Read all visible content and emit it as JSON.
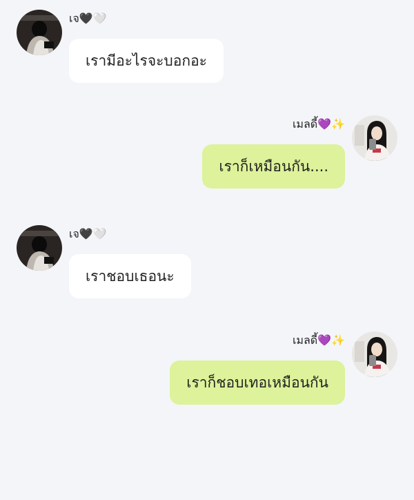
{
  "conversation": {
    "messages": [
      {
        "side": "left",
        "sender": "เจ🖤🤍",
        "text": "เรามีอะไรจะบอกอะ"
      },
      {
        "side": "right",
        "sender": "เมลดี้💜✨",
        "text": "เราก็เหมือนกัน...."
      },
      {
        "side": "left",
        "sender": "เจ🖤🤍",
        "text": "เราชอบเธอนะ"
      },
      {
        "side": "right",
        "sender": "เมลดี้💜✨",
        "text": "เราก็ชอบเทอเหมือนกัน"
      }
    ]
  },
  "colors": {
    "background": "#f4f5f9",
    "incoming_bubble": "#ffffff",
    "outgoing_bubble": "#ddf29a"
  }
}
